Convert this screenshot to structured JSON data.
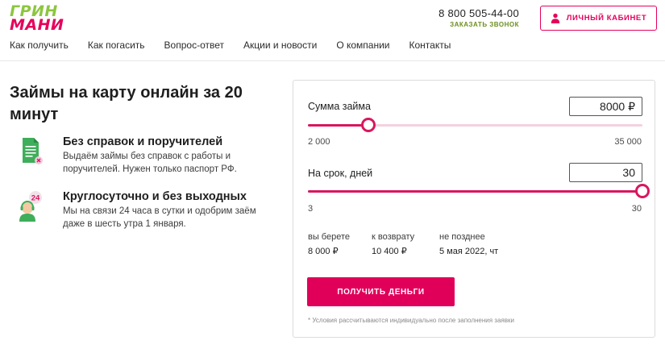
{
  "brand": {
    "logo_line1": "ГРИН",
    "logo_line2": "МАНИ",
    "logo_colors": {
      "green": "#8cc63f",
      "pink": "#e6005c"
    }
  },
  "header": {
    "phone": "8 800 505-44-00",
    "callback_link": "ЗАКАЗАТЬ ЗВОНОК",
    "cabinet_button": {
      "label": "ЛИЧНЫЙ КАБИНЕТ",
      "icon": "user-icon"
    }
  },
  "nav": {
    "items": [
      {
        "label": "Как получить"
      },
      {
        "label": "Как погасить"
      },
      {
        "label": "Вопрос-ответ"
      },
      {
        "label": "Акции и новости"
      },
      {
        "label": "О компании"
      },
      {
        "label": "Контакты"
      }
    ]
  },
  "hero": {
    "title": "Займы на карту онлайн за 20 минут"
  },
  "features": [
    {
      "icon": "document-icon",
      "title": "Без справок и поручителей",
      "text": "Выдаём займы без справок с работы и поручителей. Нужен только паспорт РФ."
    },
    {
      "icon": "support-24-icon",
      "title": "Круглосуточно и без выходных",
      "text": "Мы на связи 24 часа в сутки и одобрим заём даже в шесть утра 1 января."
    }
  ],
  "calculator": {
    "amount": {
      "label": "Сумма займа",
      "value": "8000 ₽",
      "min_label": "2 000",
      "max_label": "35 000",
      "min": 2000,
      "max": 35000,
      "current": 8000
    },
    "term": {
      "label": "На срок, дней",
      "value": "30",
      "min_label": "3",
      "max_label": "30",
      "min": 3,
      "max": 30,
      "current": 30
    },
    "summary": {
      "take_label": "вы берете",
      "take_value": "8 000 ₽",
      "return_label": "к возврату",
      "return_value": "10 400 ₽",
      "deadline_label": "не позднее",
      "deadline_value": "5 мая 2022, чт"
    },
    "submit_label": "получить деньги",
    "footnote": "* Условия рассчитываются индивидуально после заполнения заявки",
    "accent_color": "#d8175f"
  }
}
